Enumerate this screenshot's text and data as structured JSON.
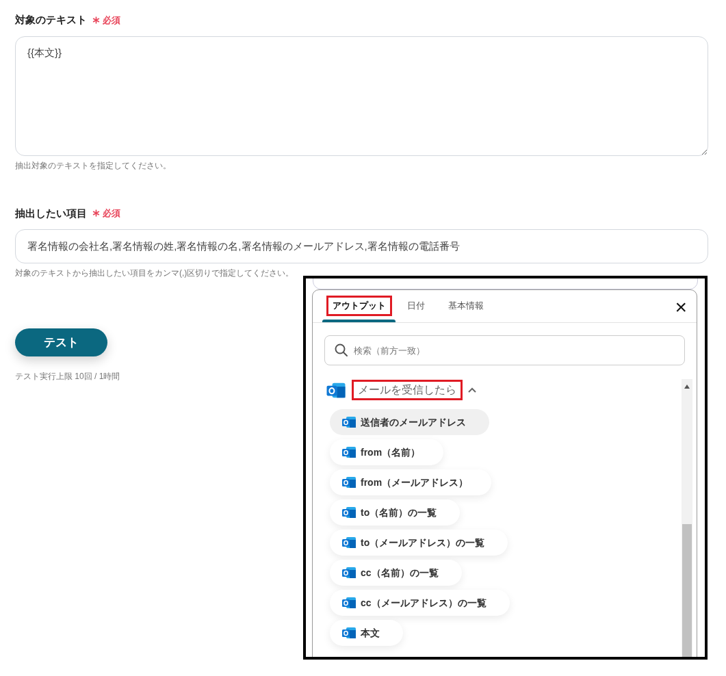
{
  "fields": [
    {
      "label": "対象のテキスト",
      "required": "必須",
      "kind": "textarea",
      "value": "{{本文}}",
      "help": "抽出対象のテキストを指定してください。"
    },
    {
      "label": "抽出したい項目",
      "required": "必須",
      "kind": "input",
      "value": "署名情報の会社名,署名情報の姓,署名情報の名,署名情報のメールアドレス,署名情報の電話番号",
      "help": "対象のテキストから抽出したい項目をカンマ(,)区切りで指定してください。"
    }
  ],
  "test_button": "テスト",
  "test_limit": "テスト実行上限 10回 / 1時間",
  "popup": {
    "tabs": [
      {
        "label": "アウトプット",
        "selected": true,
        "highlighted": true
      },
      {
        "label": "日付",
        "selected": false,
        "highlighted": false
      },
      {
        "label": "基本情報",
        "selected": false,
        "highlighted": false
      }
    ],
    "close": "×",
    "search": {
      "placeholder": "検索（前方一致）"
    },
    "group": {
      "title": "メールを受信したら",
      "highlighted": true,
      "expanded": true,
      "items": [
        {
          "label": "送信者のメールアドレス",
          "hovered": true
        },
        {
          "label": "from（名前）",
          "hovered": false
        },
        {
          "label": "from（メールアドレス）",
          "hovered": false
        },
        {
          "label": "to（名前）の一覧",
          "hovered": false
        },
        {
          "label": "to（メールアドレス）の一覧",
          "hovered": false
        },
        {
          "label": "cc（名前）の一覧",
          "hovered": false
        },
        {
          "label": "cc（メールアドレス）の一覧",
          "hovered": false
        },
        {
          "label": "本文",
          "hovered": false
        }
      ]
    }
  }
}
